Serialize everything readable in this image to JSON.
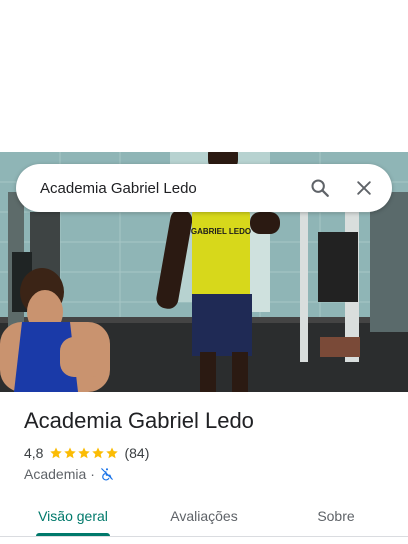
{
  "search": {
    "query": "Academia Gabriel Ledo",
    "search_icon": "search-icon",
    "close_icon": "close-icon"
  },
  "photo": {
    "shirt_text": "GABRIEL LEDO"
  },
  "place": {
    "name": "Academia Gabriel Ledo",
    "rating": "4,8",
    "stars": 5,
    "review_count": "(84)",
    "category": "Academia",
    "separator": "·",
    "accessibility_icon": "no-wheelchair-access-icon"
  },
  "tabs": [
    {
      "label": "Visão geral",
      "active": true
    },
    {
      "label": "Avaliações",
      "active": false
    },
    {
      "label": "Sobre",
      "active": false
    }
  ],
  "colors": {
    "accent": "#00796b",
    "star": "#fbbc04",
    "accessibility_icon": "#1a73e8"
  }
}
